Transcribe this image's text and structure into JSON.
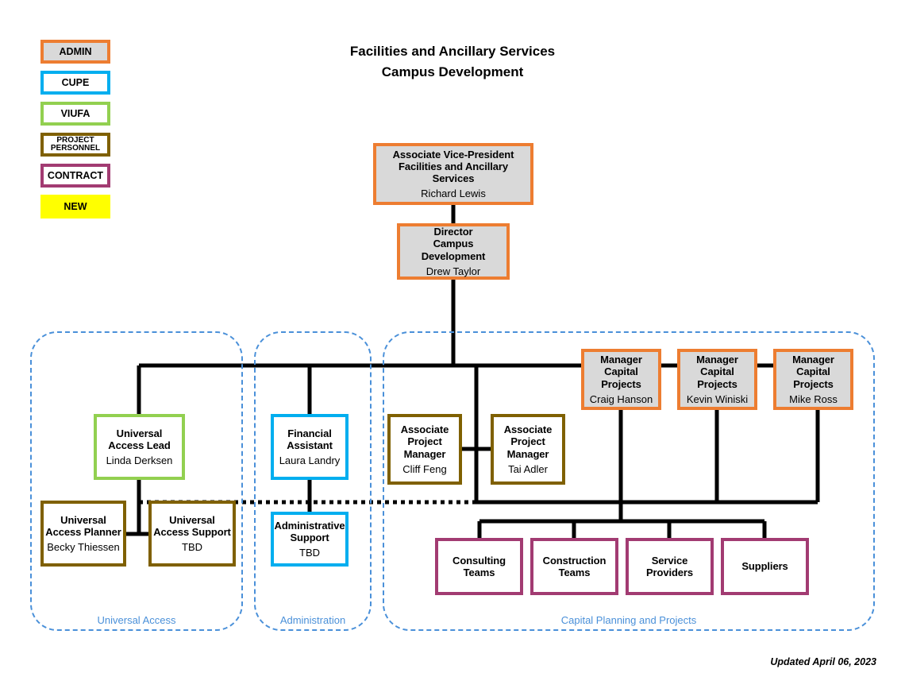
{
  "header": {
    "line1": "Facilities and Ancillary Services",
    "line2": "Campus Development"
  },
  "footer": {
    "updated": "Updated April 06, 2023"
  },
  "legend": {
    "items": [
      {
        "label": "ADMIN",
        "key": "admin",
        "border": "#ED7D31",
        "fill": "#D9D9D9"
      },
      {
        "label": "CUPE",
        "key": "cupe",
        "border": "#00AEEF",
        "fill": "#FFFFFF"
      },
      {
        "label": "VIUFA",
        "key": "viufa",
        "border": "#92D050",
        "fill": "#FFFFFF"
      },
      {
        "label": "PROJECT PERSONNEL",
        "key": "project",
        "border": "#7F6000",
        "fill": "#FFFFFF"
      },
      {
        "label": "CONTRACT",
        "key": "contract",
        "border": "#A23B72",
        "fill": "#FFFFFF"
      },
      {
        "label": "NEW",
        "key": "new",
        "border": "#FFFF00",
        "fill": "#FFFF00"
      }
    ]
  },
  "groups": [
    {
      "key": "universal-access",
      "label": "Universal Access"
    },
    {
      "key": "administration",
      "label": "Administration"
    },
    {
      "key": "capital",
      "label": "Capital Planning and Projects"
    }
  ],
  "nodes": {
    "avp": {
      "title": "Associate Vice-President Facilities and Ancillary Services",
      "title_line1": "Associate Vice-President",
      "title_line2": "Facilities and Ancillary Services",
      "person": "Richard Lewis",
      "category": "admin"
    },
    "director": {
      "title_line1": "Director",
      "title_line2": "Campus",
      "title_line3": "Development",
      "person": "Drew Taylor",
      "category": "admin"
    },
    "manager1": {
      "title_line1": "Manager",
      "title_line2": "Capital Projects",
      "person": "Craig Hanson",
      "category": "admin"
    },
    "manager2": {
      "title_line1": "Manager",
      "title_line2": "Capital Projects",
      "person": "Kevin Winiski",
      "category": "admin"
    },
    "manager3": {
      "title_line1": "Manager",
      "title_line2": "Capital Projects",
      "person": "Mike Ross",
      "category": "admin"
    },
    "ua_lead": {
      "title_line1": "Universal",
      "title_line2": "Access Lead",
      "person": "Linda Derksen",
      "category": "viufa"
    },
    "ua_planner": {
      "title_line1": "Universal",
      "title_line2": "Access Planner",
      "person": "Becky Thiessen",
      "category": "project"
    },
    "ua_support": {
      "title_line1": "Universal",
      "title_line2": "Access Support",
      "person": "TBD",
      "category": "project"
    },
    "fin_assistant": {
      "title_line1": "Financial",
      "title_line2": "Assistant",
      "person": "Laura Landry",
      "category": "cupe"
    },
    "admin_support": {
      "title_line1": "Administrative",
      "title_line2": "Support",
      "person": "TBD",
      "category": "cupe"
    },
    "apm1": {
      "title_line1": "Associate",
      "title_line2": "Project",
      "title_line3": "Manager",
      "person": "Cliff Feng",
      "category": "project"
    },
    "apm2": {
      "title_line1": "Associate",
      "title_line2": "Project",
      "title_line3": "Manager",
      "person": "Tai Adler",
      "category": "project"
    },
    "consulting": {
      "title_line1": "Consulting",
      "title_line2": "Teams",
      "category": "contract"
    },
    "construction": {
      "title_line1": "Construction",
      "title_line2": "Teams",
      "category": "contract"
    },
    "service_providers": {
      "title_line1": "Service",
      "title_line2": "Providers",
      "category": "contract"
    },
    "suppliers": {
      "title_line1": "Suppliers",
      "category": "contract"
    }
  },
  "colors": {
    "admin_border": "#ED7D31",
    "admin_fill": "#D9D9D9",
    "cupe_border": "#00AEEF",
    "viufa_border": "#92D050",
    "project_border": "#7F6000",
    "contract_border": "#A23B72",
    "new_fill": "#FFFF00",
    "group_dash": "#4A90D9",
    "connector": "#000000"
  }
}
